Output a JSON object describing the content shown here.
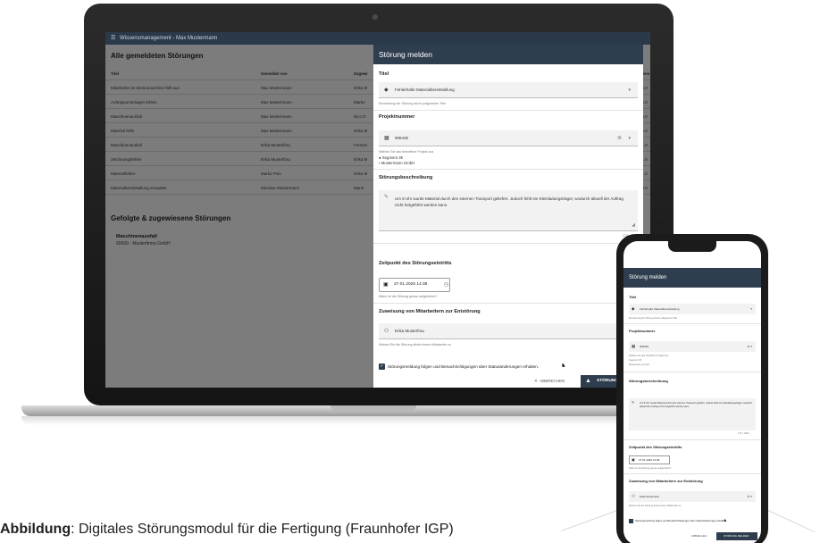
{
  "app": {
    "window_title": "Wissensmanagement - Max Mustermann"
  },
  "background": {
    "title": "Alle gemeldeten Störungen",
    "columns": [
      "Titel",
      "Gemeldet von",
      "Zugewi",
      "Gene"
    ],
    "rows": [
      [
        "Mitarbeiter an Brennmaschine fällt aus",
        "Max Mustermann",
        "Erika M",
        "06.0"
      ],
      [
        "Auftragsunterlagen fehlen",
        "Max Mustermann",
        "Marko",
        "06.0"
      ],
      [
        "Maschinenausfall",
        "Max Mustermann",
        "Nico D",
        "06.0"
      ],
      [
        "Material fehlt",
        "Max Mustermann",
        "Erika M",
        "06.0"
      ],
      [
        "Maschinenausfall",
        "Erika Musterfrau",
        "Frenzel",
        "21.0"
      ],
      [
        "Zeichnungsfehler",
        "Erika Musterfrau",
        "Erika M",
        "01.0"
      ],
      [
        "Materialfehler",
        "Marko Polo",
        "Erika M",
        "01.0"
      ],
      [
        "Materialbereitstellung verspätet",
        "Miroslav Mustermann",
        "Marie",
        "04.0"
      ]
    ],
    "followed_title": "Gefolgte & zugewiesene Störungen",
    "followed_item_title": "Maschinenausfall",
    "followed_item_sub": "90000 - Musterfirma GmbH"
  },
  "dialog": {
    "title": "Störung melden",
    "title_label": "Titel",
    "title_value": "Fehlerhafte Materialbereitstellung",
    "title_hint": "Einordnung der Störung durch prägnanten Titel",
    "project_label": "Projektnummer",
    "project_value": "908435",
    "project_hint": "Wählen Sie das betroffene Projekt aus",
    "project_segment": "Segment 35",
    "project_company": "Mustermann GmbH",
    "desc_label": "Störungsbeschreibung",
    "desc_value": "Um 8 Uhr wurde Material durch den internen Transport geliefert. Jedoch fehlt ein Kleinladungsträger, wodurch aktuell der Auftrag nicht fortgeführt werden kann.",
    "desc_counter": "174 / 1000",
    "time_label": "Zeitpunkt des Störungseintritts",
    "time_value": "27.01.2026 14:38",
    "time_hint": "Wann ist die Störung genau aufgetreten?",
    "assign_label": "Zuweisung von Mitarbeitern zur Entstörung",
    "assign_value": "Erika Musterfrau",
    "assign_hint": "Weisen Sie die Störung direkt einem Mitarbeiter zu",
    "follow_label": "Störungsmeldung folgen und Benachrichtigungen über Statusänderungen erhalten.",
    "cancel_label": "ABBRECHEN",
    "submit_label": "STÖRUNG"
  },
  "phone": {
    "title": "Störung melden",
    "title_label": "Titel",
    "title_value": "Fehlerhafte Materialbereitstellung",
    "title_hint": "Einordnung der Störung durch prägnanten Titel",
    "project_label": "Projektnummer",
    "project_value": "908435",
    "project_hint": "Wählen Sie das betroffene Projekt aus",
    "project_segment": "Segment 35",
    "project_company": "Mustermann GmbH",
    "desc_label": "Störungsbeschreibung",
    "desc_value": "Um 8 Uhr wurde Material durch den internen Transport geliefert. Jedoch fehlt ein Kleinladungsträger, wodurch aktuell der Auftrag nicht fortgeführt werden kann.",
    "desc_counter": "174 / 1000",
    "time_label": "Zeitpunkt des Störungseintritts",
    "time_value": "27.01.2026 14:38",
    "time_hint": "Wann ist die Störung genau aufgetreten?",
    "assign_label": "Zuweisung von Mitarbeitern zur Entstörung",
    "assign_value": "Erika Musterfrau",
    "assign_hint": "Weisen Sie die Störung direkt einem Mitarbeiter zu",
    "follow_label": "Störungsmeldung folgen und Benachrichtigungen über Statusänderungen erhalten.",
    "cancel_label": "ABBRECHEN",
    "submit_label": "STÖRUNG MELDEN"
  },
  "caption": {
    "bold": "Abbildung",
    "text": ": Digitales Störungsmodul für die Fertigung (Fraunhofer IGP)"
  },
  "colors": {
    "header": "#2f3e4e",
    "titlebar": "#2b3a4a"
  },
  "icons": [
    "menu-icon",
    "label-icon",
    "building-icon",
    "edit-icon",
    "calendar-icon",
    "clock-icon",
    "person-add-icon",
    "bell-icon",
    "close-icon",
    "warning-icon",
    "dropdown-caret-icon",
    "clear-icon"
  ]
}
